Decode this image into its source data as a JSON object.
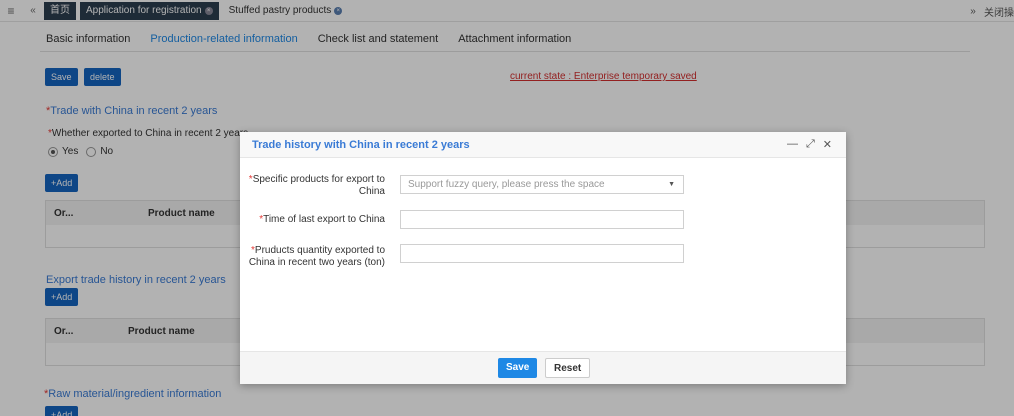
{
  "topbar": {
    "menu_icon": "hamburger-icon",
    "prev_icon": "double-left-icon",
    "tabs": [
      {
        "label": "首页"
      },
      {
        "label": "Application for registration"
      },
      {
        "label": "Stuffed pastry products"
      }
    ],
    "next_icon": "double-right-icon",
    "close_ops_label": "关闭操作"
  },
  "subtabs": [
    "Basic information",
    "Production-related information",
    "Check list and statement",
    "Attachment information"
  ],
  "toolbar": {
    "save_label": "Save",
    "delete_label": "delete"
  },
  "status": "current state : Enterprise temporary saved",
  "trade_section": {
    "title": "Trade with China in recent 2 years",
    "question": "Whether exported to China in recent 2 years",
    "yes_label": "Yes",
    "no_label": "No",
    "yes_selected": true,
    "add_label": "+Add",
    "columns": [
      "Or...",
      "Product name"
    ]
  },
  "export_section": {
    "title": "Export trade history in recent 2 years",
    "add_label": "+Add",
    "columns": [
      "Or...",
      "Product name"
    ]
  },
  "raw_section": {
    "title": "Raw material/ingredient information",
    "add_label": "+Add"
  },
  "modal": {
    "title": "Trade history with China in recent 2 years",
    "minimize_icon": "minimize-icon",
    "maximize_icon": "maximize-icon",
    "close_icon": "close-icon",
    "fields": [
      {
        "label": "Specific products for export to China",
        "placeholder": "Support fuzzy query, please press the space",
        "value": ""
      },
      {
        "label": "Time of last export to China",
        "placeholder": "",
        "value": ""
      },
      {
        "label": "Pruducts quantity exported to China in recent two years (ton)",
        "placeholder": "",
        "value": ""
      }
    ],
    "save_label": "Save",
    "reset_label": "Reset"
  },
  "colors": {
    "accent": "#1e88e5",
    "nav_dark": "#2c3e50",
    "status_red": "#d32f2f",
    "section_blue": "#3a7bd5"
  }
}
